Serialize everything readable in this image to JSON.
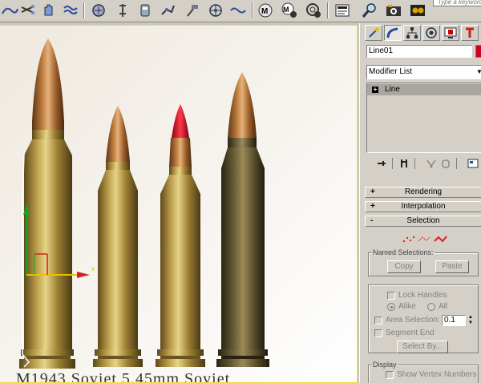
{
  "toolbar": {
    "search_placeholder": "Type a keyword",
    "icons": [
      "curve-icon",
      "scissors-icon",
      "hand-icon",
      "wave-icon",
      "snapshot-icon",
      "pin-icon",
      "cylinder-icon",
      "bones-icon",
      "hammer-icon",
      "target-icon",
      "wave-icon",
      "m-shirt-icon",
      "m-ball-icon",
      "m-spiral-icon",
      "render-frame-icon",
      "magnifier-icon",
      "camera-icon",
      "film-icon"
    ]
  },
  "viewport": {
    "bottom_caption": "M1943 Soviet 5.45mm Soviet",
    "gizmo_axis_label": "x",
    "colors": {
      "border_active": "#f0e040",
      "gizmo_x": "#d22020",
      "gizmo_y": "#20a020",
      "gizmo_z": "#f0c000"
    }
  },
  "command_panel": {
    "tabs": [
      "create-icon",
      "modify-icon",
      "hierarchy-icon",
      "motion-icon",
      "display-icon",
      "utilities-icon"
    ],
    "object_name": "Line01",
    "object_color": "#d2001e",
    "modifier_list_label": "Modifier List",
    "stack_item": "Line",
    "rollouts": {
      "rendering": {
        "sign": "+",
        "title": "Rendering"
      },
      "interpolation": {
        "sign": "+",
        "title": "Interpolation"
      },
      "selection": {
        "sign": "-",
        "title": "Selection",
        "named_selections_label": "Named Selections:",
        "copy_label": "Copy",
        "paste_label": "Paste",
        "lock_handles_label": "Lock Handles",
        "alike_label": "Alike",
        "all_label": "All",
        "area_selection_label": "Area Selection:",
        "area_selection_value": "0.1",
        "segment_end_label": "Segment End",
        "select_by_label": "Select By...",
        "display_label": "Display",
        "show_vertex_numbers_label": "Show Vertex Numbers"
      }
    }
  }
}
